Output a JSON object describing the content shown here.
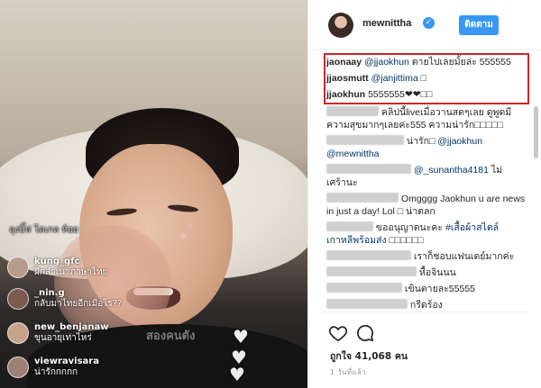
{
  "live_overlay": {
    "top_faint_text": "ลุงบิ๊ฟ โดเกล ห้อย",
    "big_caption": "สองคนดัง",
    "comments": [
      {
        "user": "kung_gfc",
        "message": "ฝึกสำเนาภาษาไทย"
      },
      {
        "user": "_nin.g",
        "message": "กลับมาไทยอีกเมื่อไร??"
      },
      {
        "user": "new_benjanaw",
        "message": "ขุนอายุเท่าไหร่"
      },
      {
        "user": "viewravisara",
        "message": "น่ารักกกกก"
      }
    ],
    "avatar_colors": [
      "#b89a8a",
      "#7d5a4f",
      "#c7a28d",
      "#9a8174"
    ]
  },
  "post": {
    "username": "mewnittha",
    "follow_label": "ติดตาม",
    "accent_color": "#3897f0",
    "highlight_color": "#d0262b",
    "highlighted_comments": [
      {
        "user": "jaonaay",
        "mention": "@jjaokhun",
        "text": "ตายไปเลยมั้ยล่ะ 555555"
      },
      {
        "user": "jjaosmutt",
        "mention": "@janjittima",
        "text": "□"
      },
      {
        "user": "jjaokhun",
        "text": "5555555❤❤□□"
      }
    ],
    "comments": [
      {
        "line1": "คลิปนี้liveเมื่อวานสดๆเลย ดูพูดมี",
        "line2": "ความสุขมากๆเลยค่ะ555 ความน่ารัก□□□□□"
      },
      {
        "text": "น่ารัก□ ",
        "mention": "@jjaokhun",
        "line2_mention": "@mewnittha"
      },
      {
        "mention": "@_sunantha4181",
        "text": " ไม่",
        "line2": "เศร้านะ"
      },
      {
        "text": " Omgggg Jaokhun u are news",
        "line2": "in just a day! Lol □ น่าตลก"
      },
      {
        "text": " ขออนุญาตนะคะ ",
        "hashtag": "#เสื้อผ้าสไตล์",
        "line2_hashtag": "เกาหลีพร้อมส่ง",
        "line2_tail": " □□□□□□"
      },
      {
        "text": " เราก็ชอบแฟนเดย์มากค่ะ"
      },
      {
        "text": " หื้อจินนน"
      },
      {
        "text": " เขินตายละ55555"
      },
      {
        "text": " กรีดร้อง"
      }
    ],
    "likes_label": "ถูกใจ 41,068 คน",
    "time_label": "1 วันที่แล้ว",
    "icons": [
      "heart-outline-icon",
      "comment-icon"
    ]
  }
}
